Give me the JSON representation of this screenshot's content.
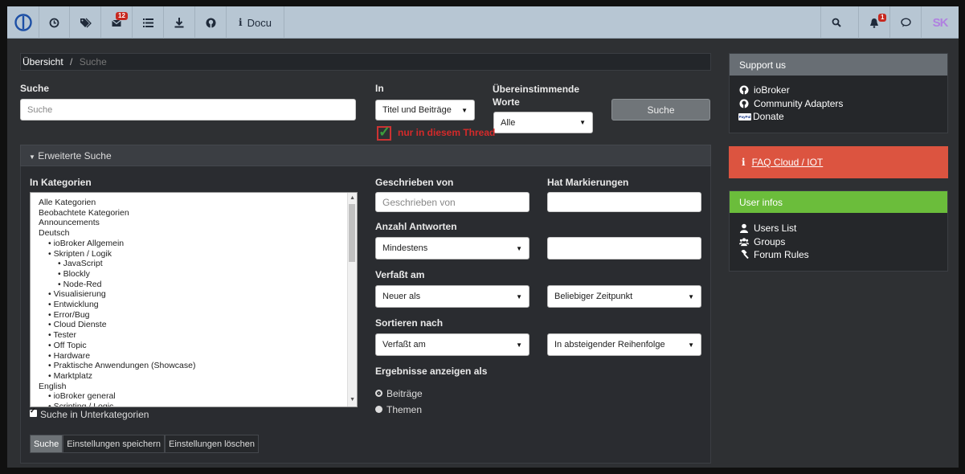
{
  "navbar": {
    "docu_label": "Docu",
    "messages_badge": "12",
    "notifications_badge": "1",
    "avatar_text": "SK"
  },
  "breadcrumb": {
    "home": "Übersicht",
    "separator": "/",
    "current": "Suche"
  },
  "search": {
    "label": "Suche",
    "placeholder": "Suche",
    "in_label": "In",
    "in_value": "Titel und Beiträge",
    "match_label": "Übereinstimmende Worte",
    "match_value": "Alle",
    "button": "Suche",
    "thread_only": "nur in diesem Thread"
  },
  "advanced": {
    "title": "Erweiterte Suche",
    "categories_label": "In Kategorien",
    "categories": [
      "Alle Kategorien",
      "Beobachtete Kategorien",
      "Announcements",
      "Deutsch",
      "• ioBroker Allgemein",
      "• Skripten / Logik",
      "• JavaScript",
      "• Blockly",
      "• Node-Red",
      "• Visualisierung",
      "• Entwicklung",
      "• Error/Bug",
      "• Cloud Dienste",
      "• Tester",
      "• Off Topic",
      "• Hardware",
      "• Praktische Anwendungen (Showcase)",
      "• Marktplatz",
      "English",
      "• ioBroker general",
      "• Scripting / Logic"
    ],
    "subcategories": "Suche in Unterkategorien",
    "written_by_label": "Geschrieben von",
    "written_by_placeholder": "Geschrieben von",
    "tags_label": "Hat Markierungen",
    "replies_label": "Anzahl Antworten",
    "replies_value": "Mindestens",
    "posted_label": "Verfaßt am",
    "posted_value": "Neuer als",
    "posted_time": "Beliebiger Zeitpunkt",
    "sort_label": "Sortieren nach",
    "sort_value": "Verfaßt am",
    "sort_order": "In absteigender Reihenfolge",
    "show_as_label": "Ergebnisse anzeigen als",
    "show_posts": "Beiträge",
    "show_topics": "Themen",
    "btn_search": "Suche",
    "btn_save": "Einstellungen speichern",
    "btn_clear": "Einstellungen löschen"
  },
  "sidebar": {
    "support_title": "Support us",
    "support_items": [
      "ioBroker",
      "Community Adapters",
      "Donate"
    ],
    "paypal_text": "PayPal",
    "faq_label": "FAQ Cloud / IOT",
    "user_title": "User infos",
    "user_items": [
      "Users List",
      "Groups",
      "Forum Rules"
    ]
  },
  "colors": {
    "navbar": "#b7c6d3",
    "faq": "#dc5440",
    "user_head": "#6bbd3b",
    "panel_head": "#686e74"
  }
}
